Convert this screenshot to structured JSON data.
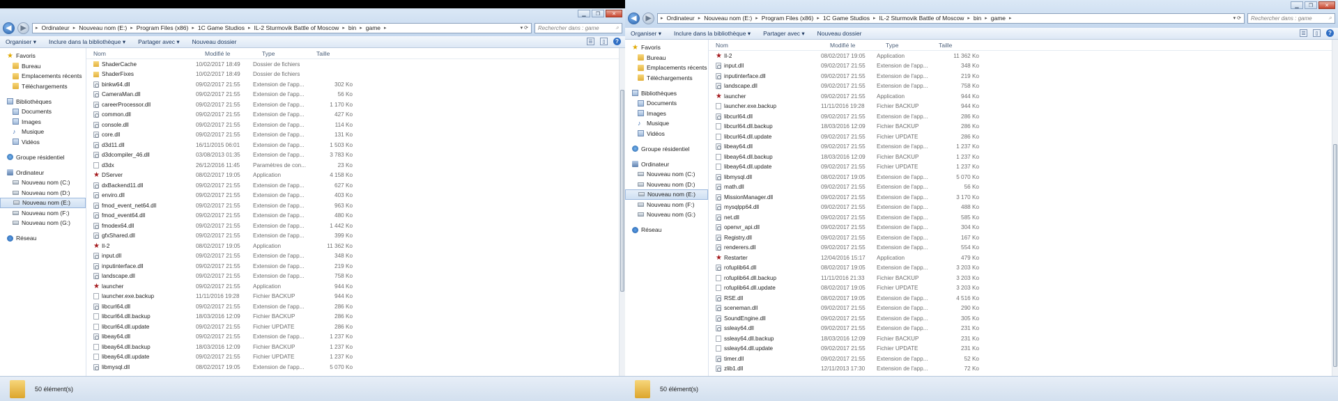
{
  "search_placeholder": "Rechercher dans : game",
  "breadcrumb": [
    "Ordinateur",
    "Nouveau nom (E:)",
    "Program Files (x86)",
    "1C Game Studios",
    "IL-2 Sturmovik Battle of Moscow",
    "bin",
    "game"
  ],
  "toolbar": {
    "organize": "Organiser",
    "include": "Inclure dans la bibliothèque",
    "share": "Partager avec",
    "new_folder": "Nouveau dossier"
  },
  "columns": {
    "name": "Nom",
    "date": "Modifié le",
    "type": "Type",
    "size": "Taille"
  },
  "nav": {
    "favorites": "Favoris",
    "desktop": "Bureau",
    "recent": "Emplacements récents",
    "downloads": "Téléchargements",
    "libraries": "Bibliothèques",
    "documents": "Documents",
    "images": "Images",
    "music": "Musique",
    "videos": "Vidéos",
    "homegroup": "Groupe résidentiel",
    "computer": "Ordinateur",
    "drives": [
      "Nouveau nom (C:)",
      "Nouveau nom (D:)",
      "Nouveau nom (E:)",
      "Nouveau nom (F:)",
      "Nouveau nom (G:)"
    ],
    "network": "Réseau"
  },
  "status": "50 élément(s)",
  "window1_files": [
    {
      "name": "ShaderCache",
      "date": "10/02/2017 18:49",
      "type": "Dossier de fichiers",
      "size": "",
      "icon": "folder"
    },
    {
      "name": "ShaderFixes",
      "date": "10/02/2017 18:49",
      "type": "Dossier de fichiers",
      "size": "",
      "icon": "folder"
    },
    {
      "name": "binkw64.dll",
      "date": "09/02/2017 21:55",
      "type": "Extension de l'app...",
      "size": "302 Ko",
      "icon": "dll"
    },
    {
      "name": "CameraMan.dll",
      "date": "09/02/2017 21:55",
      "type": "Extension de l'app...",
      "size": "56 Ko",
      "icon": "dll"
    },
    {
      "name": "careerProcessor.dll",
      "date": "09/02/2017 21:55",
      "type": "Extension de l'app...",
      "size": "1 170 Ko",
      "icon": "dll"
    },
    {
      "name": "common.dll",
      "date": "09/02/2017 21:55",
      "type": "Extension de l'app...",
      "size": "427 Ko",
      "icon": "dll"
    },
    {
      "name": "console.dll",
      "date": "09/02/2017 21:55",
      "type": "Extension de l'app...",
      "size": "114 Ko",
      "icon": "dll"
    },
    {
      "name": "core.dll",
      "date": "09/02/2017 21:55",
      "type": "Extension de l'app...",
      "size": "131 Ko",
      "icon": "dll"
    },
    {
      "name": "d3d11.dll",
      "date": "16/11/2015 06:01",
      "type": "Extension de l'app...",
      "size": "1 503 Ko",
      "icon": "dll"
    },
    {
      "name": "d3dcompiler_46.dll",
      "date": "03/08/2013 01:35",
      "type": "Extension de l'app...",
      "size": "3 783 Ko",
      "icon": "dll"
    },
    {
      "name": "d3dx",
      "date": "26/12/2016 11:45",
      "type": "Paramètres de con...",
      "size": "23 Ko",
      "icon": "doc"
    },
    {
      "name": "DServer",
      "date": "08/02/2017 19:05",
      "type": "Application",
      "size": "4 158 Ko",
      "icon": "app"
    },
    {
      "name": "dxBackend11.dll",
      "date": "09/02/2017 21:55",
      "type": "Extension de l'app...",
      "size": "627 Ko",
      "icon": "dll"
    },
    {
      "name": "enviro.dll",
      "date": "09/02/2017 21:55",
      "type": "Extension de l'app...",
      "size": "403 Ko",
      "icon": "dll"
    },
    {
      "name": "fmod_event_net64.dll",
      "date": "09/02/2017 21:55",
      "type": "Extension de l'app...",
      "size": "963 Ko",
      "icon": "dll"
    },
    {
      "name": "fmod_event64.dll",
      "date": "09/02/2017 21:55",
      "type": "Extension de l'app...",
      "size": "480 Ko",
      "icon": "dll"
    },
    {
      "name": "fmodex64.dll",
      "date": "09/02/2017 21:55",
      "type": "Extension de l'app...",
      "size": "1 442 Ko",
      "icon": "dll"
    },
    {
      "name": "gfxShared.dll",
      "date": "09/02/2017 21:55",
      "type": "Extension de l'app...",
      "size": "399 Ko",
      "icon": "dll"
    },
    {
      "name": "Il-2",
      "date": "08/02/2017 19:05",
      "type": "Application",
      "size": "11 362 Ko",
      "icon": "app"
    },
    {
      "name": "input.dll",
      "date": "09/02/2017 21:55",
      "type": "Extension de l'app...",
      "size": "348 Ko",
      "icon": "dll"
    },
    {
      "name": "inputinterface.dll",
      "date": "09/02/2017 21:55",
      "type": "Extension de l'app...",
      "size": "219 Ko",
      "icon": "dll"
    },
    {
      "name": "landscape.dll",
      "date": "09/02/2017 21:55",
      "type": "Extension de l'app...",
      "size": "758 Ko",
      "icon": "dll"
    },
    {
      "name": "launcher",
      "date": "09/02/2017 21:55",
      "type": "Application",
      "size": "944 Ko",
      "icon": "app"
    },
    {
      "name": "launcher.exe.backup",
      "date": "11/11/2016 19:28",
      "type": "Fichier BACKUP",
      "size": "944 Ko",
      "icon": "doc"
    },
    {
      "name": "libcurl64.dll",
      "date": "09/02/2017 21:55",
      "type": "Extension de l'app...",
      "size": "286 Ko",
      "icon": "dll"
    },
    {
      "name": "libcurl64.dll.backup",
      "date": "18/03/2016 12:09",
      "type": "Fichier BACKUP",
      "size": "286 Ko",
      "icon": "doc"
    },
    {
      "name": "libcurl64.dll.update",
      "date": "09/02/2017 21:55",
      "type": "Fichier UPDATE",
      "size": "286 Ko",
      "icon": "doc"
    },
    {
      "name": "libeay64.dll",
      "date": "09/02/2017 21:55",
      "type": "Extension de l'app...",
      "size": "1 237 Ko",
      "icon": "dll"
    },
    {
      "name": "libeay64.dll.backup",
      "date": "18/03/2016 12:09",
      "type": "Fichier BACKUP",
      "size": "1 237 Ko",
      "icon": "doc"
    },
    {
      "name": "libeay64.dll.update",
      "date": "09/02/2017 21:55",
      "type": "Fichier UPDATE",
      "size": "1 237 Ko",
      "icon": "doc"
    },
    {
      "name": "libmysql.dll",
      "date": "08/02/2017 19:05",
      "type": "Extension de l'app...",
      "size": "5 070 Ko",
      "icon": "dll"
    }
  ],
  "window2_files": [
    {
      "name": "Il-2",
      "date": "08/02/2017 19:05",
      "type": "Application",
      "size": "11 362 Ko",
      "icon": "app"
    },
    {
      "name": "input.dll",
      "date": "09/02/2017 21:55",
      "type": "Extension de l'app...",
      "size": "348 Ko",
      "icon": "dll"
    },
    {
      "name": "inputinterface.dll",
      "date": "09/02/2017 21:55",
      "type": "Extension de l'app...",
      "size": "219 Ko",
      "icon": "dll"
    },
    {
      "name": "landscape.dll",
      "date": "09/02/2017 21:55",
      "type": "Extension de l'app...",
      "size": "758 Ko",
      "icon": "dll"
    },
    {
      "name": "launcher",
      "date": "09/02/2017 21:55",
      "type": "Application",
      "size": "944 Ko",
      "icon": "app"
    },
    {
      "name": "launcher.exe.backup",
      "date": "11/11/2016 19:28",
      "type": "Fichier BACKUP",
      "size": "944 Ko",
      "icon": "doc"
    },
    {
      "name": "libcurl64.dll",
      "date": "09/02/2017 21:55",
      "type": "Extension de l'app...",
      "size": "286 Ko",
      "icon": "dll"
    },
    {
      "name": "libcurl64.dll.backup",
      "date": "18/03/2016 12:09",
      "type": "Fichier BACKUP",
      "size": "286 Ko",
      "icon": "doc"
    },
    {
      "name": "libcurl64.dll.update",
      "date": "09/02/2017 21:55",
      "type": "Fichier UPDATE",
      "size": "286 Ko",
      "icon": "doc"
    },
    {
      "name": "libeay64.dll",
      "date": "09/02/2017 21:55",
      "type": "Extension de l'app...",
      "size": "1 237 Ko",
      "icon": "dll"
    },
    {
      "name": "libeay64.dll.backup",
      "date": "18/03/2016 12:09",
      "type": "Fichier BACKUP",
      "size": "1 237 Ko",
      "icon": "doc"
    },
    {
      "name": "libeay64.dll.update",
      "date": "09/02/2017 21:55",
      "type": "Fichier UPDATE",
      "size": "1 237 Ko",
      "icon": "doc"
    },
    {
      "name": "libmysql.dll",
      "date": "08/02/2017 19:05",
      "type": "Extension de l'app...",
      "size": "5 070 Ko",
      "icon": "dll"
    },
    {
      "name": "math.dll",
      "date": "09/02/2017 21:55",
      "type": "Extension de l'app...",
      "size": "56 Ko",
      "icon": "dll"
    },
    {
      "name": "MissionManager.dll",
      "date": "09/02/2017 21:55",
      "type": "Extension de l'app...",
      "size": "3 170 Ko",
      "icon": "dll"
    },
    {
      "name": "mysqlpp64.dll",
      "date": "09/02/2017 21:55",
      "type": "Extension de l'app...",
      "size": "488 Ko",
      "icon": "dll"
    },
    {
      "name": "net.dll",
      "date": "09/02/2017 21:55",
      "type": "Extension de l'app...",
      "size": "585 Ko",
      "icon": "dll"
    },
    {
      "name": "openvr_api.dll",
      "date": "09/02/2017 21:55",
      "type": "Extension de l'app...",
      "size": "304 Ko",
      "icon": "dll"
    },
    {
      "name": "Registry.dll",
      "date": "09/02/2017 21:55",
      "type": "Extension de l'app...",
      "size": "167 Ko",
      "icon": "dll"
    },
    {
      "name": "renderers.dll",
      "date": "09/02/2017 21:55",
      "type": "Extension de l'app...",
      "size": "554 Ko",
      "icon": "dll"
    },
    {
      "name": "Restarter",
      "date": "12/04/2016 15:17",
      "type": "Application",
      "size": "479 Ko",
      "icon": "app"
    },
    {
      "name": "rofuplib64.dll",
      "date": "08/02/2017 19:05",
      "type": "Extension de l'app...",
      "size": "3 203 Ko",
      "icon": "dll"
    },
    {
      "name": "rofuplib64.dll.backup",
      "date": "11/11/2016 21:33",
      "type": "Fichier BACKUP",
      "size": "3 203 Ko",
      "icon": "doc"
    },
    {
      "name": "rofuplib64.dll.update",
      "date": "08/02/2017 19:05",
      "type": "Fichier UPDATE",
      "size": "3 203 Ko",
      "icon": "doc"
    },
    {
      "name": "RSE.dll",
      "date": "08/02/2017 19:05",
      "type": "Extension de l'app...",
      "size": "4 516 Ko",
      "icon": "dll"
    },
    {
      "name": "sceneman.dll",
      "date": "09/02/2017 21:55",
      "type": "Extension de l'app...",
      "size": "290 Ko",
      "icon": "dll"
    },
    {
      "name": "SoundEngine.dll",
      "date": "09/02/2017 21:55",
      "type": "Extension de l'app...",
      "size": "305 Ko",
      "icon": "dll"
    },
    {
      "name": "ssleay64.dll",
      "date": "09/02/2017 21:55",
      "type": "Extension de l'app...",
      "size": "231 Ko",
      "icon": "dll"
    },
    {
      "name": "ssleay64.dll.backup",
      "date": "18/03/2016 12:09",
      "type": "Fichier BACKUP",
      "size": "231 Ko",
      "icon": "doc"
    },
    {
      "name": "ssleay64.dll.update",
      "date": "09/02/2017 21:55",
      "type": "Fichier UPDATE",
      "size": "231 Ko",
      "icon": "doc"
    },
    {
      "name": "timer.dll",
      "date": "09/02/2017 21:55",
      "type": "Extension de l'app...",
      "size": "52 Ko",
      "icon": "dll"
    },
    {
      "name": "zlib1.dll",
      "date": "12/11/2013 17:30",
      "type": "Extension de l'app...",
      "size": "72 Ko",
      "icon": "dll"
    }
  ]
}
